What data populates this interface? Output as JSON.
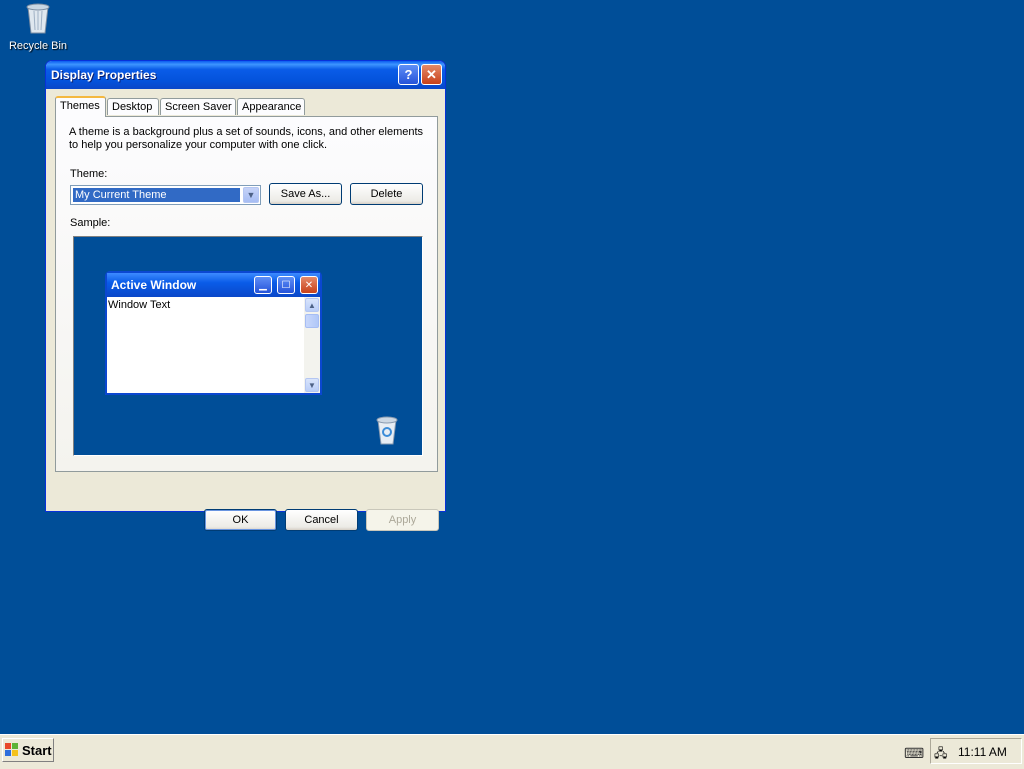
{
  "desktop": {
    "background": "#004e98",
    "icons": [
      {
        "label": "Recycle Bin",
        "icon": "recycle-bin-icon"
      }
    ]
  },
  "window": {
    "title": "Display Properties",
    "help_icon": "help-icon",
    "close_icon": "close-icon",
    "tabs": [
      {
        "label": "Themes",
        "active": true
      },
      {
        "label": "Desktop",
        "active": false
      },
      {
        "label": "Screen Saver",
        "active": false
      },
      {
        "label": "Appearance",
        "active": false
      }
    ],
    "themes": {
      "description": "A theme is a background plus a set of sounds, icons, and other elements to help you personalize your computer with one click.",
      "theme_label": "Theme:",
      "theme_value": "My Current Theme",
      "save_as_label": "Save As...",
      "delete_label": "Delete",
      "sample_label": "Sample:",
      "sample": {
        "window_title": "Active Window",
        "window_text": "Window Text"
      }
    },
    "buttons": {
      "ok": "OK",
      "cancel": "Cancel",
      "apply": "Apply"
    }
  },
  "taskbar": {
    "start_label": "Start",
    "clock": "11:11 AM"
  }
}
